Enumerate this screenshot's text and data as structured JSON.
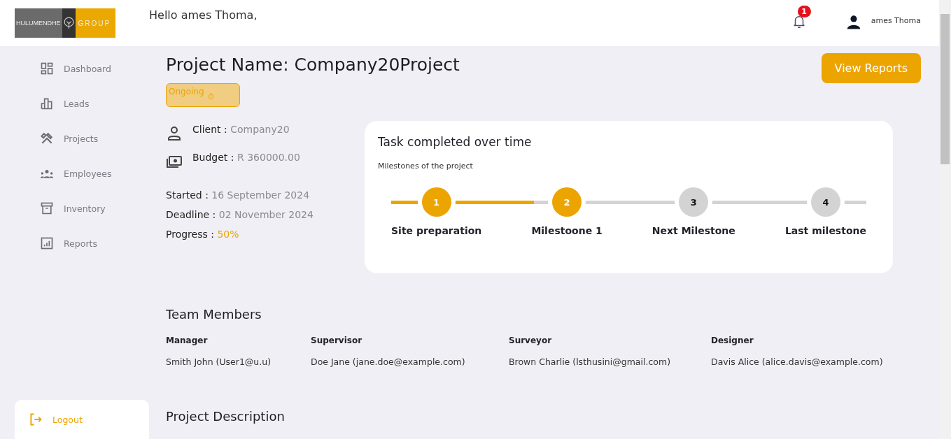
{
  "header": {
    "logo": {
      "left": "HULUMENDHE",
      "right": "GROUP"
    },
    "greeting": "Hello ames Thoma,",
    "notifications": {
      "count": "1"
    },
    "user": {
      "name": "ames Thoma"
    }
  },
  "sidebar": {
    "items": [
      {
        "label": "Dashboard",
        "kind": "dashboard"
      },
      {
        "label": "Leads",
        "kind": "leads"
      },
      {
        "label": "Projects",
        "kind": "projects"
      },
      {
        "label": "Employees",
        "kind": "employees"
      },
      {
        "label": "Inventory",
        "kind": "inventory"
      },
      {
        "label": "Reports",
        "kind": "reports"
      }
    ],
    "logout": "Logout"
  },
  "project": {
    "title": "Project Name: Company20Project",
    "status": "Ongoing",
    "view_reports": "View Reports",
    "details": [
      {
        "kind": "client",
        "label": "Client :",
        "value": "Company20"
      },
      {
        "kind": "budget",
        "label": "Budget :",
        "value": "R 360000.00"
      }
    ],
    "dates": [
      {
        "kind": "plain",
        "label": "Started :",
        "value": "16 September 2024"
      },
      {
        "kind": "plain",
        "label": "Deadline :",
        "value": "02 November 2024"
      },
      {
        "kind": "accent",
        "label": "Progress :",
        "value": "50%"
      }
    ]
  },
  "milestones_card": {
    "title": "Task completed over time",
    "subtitle": "Milestones of the project",
    "track": {
      "level": 0.3
    },
    "milestones": [
      {
        "number": "1",
        "label": "Site preparation",
        "completed": true
      },
      {
        "number": "2",
        "label": "Milestoone 1",
        "completed": true
      },
      {
        "number": "3",
        "label": "Next Milestone",
        "completed": false
      },
      {
        "number": "4",
        "label": "Last milestone",
        "completed": false
      }
    ]
  },
  "team": {
    "title": "Team Members",
    "members": [
      {
        "role": "Manager",
        "person": "Smith John (User1@u.u)"
      },
      {
        "role": "Supervisor",
        "person": "Doe Jane (jane.doe@example.com)"
      },
      {
        "role": "Surveyor",
        "person": "Brown Charlie (lsthusini@gmail.com)"
      },
      {
        "role": "Designer",
        "person": "Davis Alice (alice.davis@example.com)"
      }
    ]
  },
  "description": {
    "title": "Project Description"
  }
}
